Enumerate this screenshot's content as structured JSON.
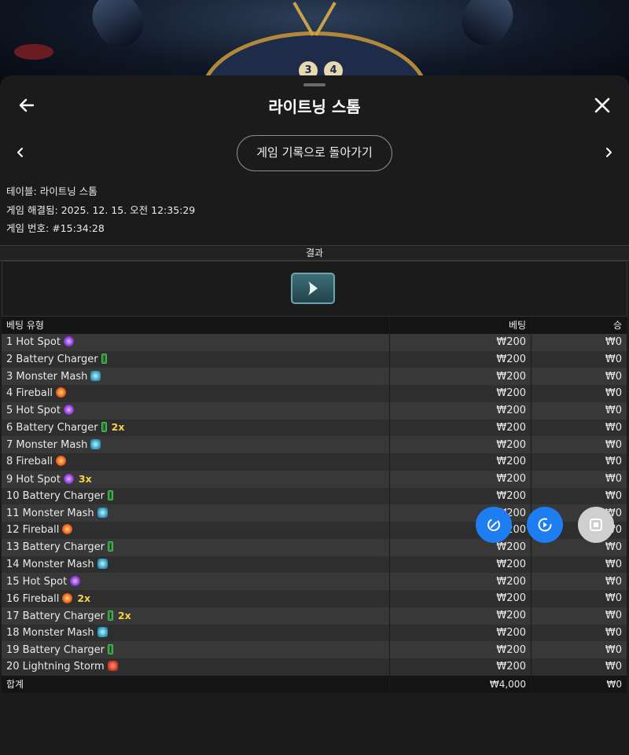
{
  "header": {
    "title": "라이트닝 스톰"
  },
  "background": {
    "wheel_numbers": [
      "3",
      "4"
    ]
  },
  "nav": {
    "back_to_history": "게임 기록으로 돌아가기"
  },
  "info": {
    "table_label": "테이블:",
    "table_value": "라이트닝 스톰",
    "resolved_label": "게임 해결됨:",
    "resolved_value": "2025. 12. 15. 오전 12:35:29",
    "game_no_label": "게임 번호:",
    "game_no_value": "#15:34:28"
  },
  "result": {
    "heading": "결과",
    "icon": "arrow-card-icon"
  },
  "bets": {
    "columns": {
      "type": "베팅 유형",
      "bet": "베팅",
      "win": "승"
    },
    "rows": [
      {
        "label": "1 Hot Spot",
        "icon": "hot-spot",
        "mult": "",
        "bet": "₩200",
        "win": "₩0"
      },
      {
        "label": "2 Battery Charger",
        "icon": "battery",
        "mult": "",
        "bet": "₩200",
        "win": "₩0"
      },
      {
        "label": "3 Monster Mash",
        "icon": "monster",
        "mult": "",
        "bet": "₩200",
        "win": "₩0"
      },
      {
        "label": "4 Fireball",
        "icon": "fireball",
        "mult": "",
        "bet": "₩200",
        "win": "₩0"
      },
      {
        "label": "5 Hot Spot",
        "icon": "hot-spot",
        "mult": "",
        "bet": "₩200",
        "win": "₩0"
      },
      {
        "label": "6 Battery Charger",
        "icon": "battery",
        "mult": "2x",
        "bet": "₩200",
        "win": "₩0"
      },
      {
        "label": "7 Monster Mash",
        "icon": "monster",
        "mult": "",
        "bet": "₩200",
        "win": "₩0"
      },
      {
        "label": "8 Fireball",
        "icon": "fireball",
        "mult": "",
        "bet": "₩200",
        "win": "₩0"
      },
      {
        "label": "9 Hot Spot",
        "icon": "hot-spot",
        "mult": "3x",
        "bet": "₩200",
        "win": "₩0"
      },
      {
        "label": "10 Battery Charger",
        "icon": "battery",
        "mult": "",
        "bet": "₩200",
        "win": "₩0"
      },
      {
        "label": "11 Monster Mash",
        "icon": "monster",
        "mult": "",
        "bet": "₩200",
        "win": "₩0"
      },
      {
        "label": "12 Fireball",
        "icon": "fireball",
        "mult": "",
        "bet": "₩200",
        "win": "₩0"
      },
      {
        "label": "13 Battery Charger",
        "icon": "battery",
        "mult": "",
        "bet": "₩200",
        "win": "₩0"
      },
      {
        "label": "14 Monster Mash",
        "icon": "monster",
        "mult": "",
        "bet": "₩200",
        "win": "₩0"
      },
      {
        "label": "15 Hot Spot",
        "icon": "hot-spot",
        "mult": "",
        "bet": "₩200",
        "win": "₩0"
      },
      {
        "label": "16 Fireball",
        "icon": "fireball",
        "mult": "2x",
        "bet": "₩200",
        "win": "₩0"
      },
      {
        "label": "17 Battery Charger",
        "icon": "battery",
        "mult": "2x",
        "bet": "₩200",
        "win": "₩0"
      },
      {
        "label": "18 Monster Mash",
        "icon": "monster",
        "mult": "",
        "bet": "₩200",
        "win": "₩0"
      },
      {
        "label": "19 Battery Charger",
        "icon": "battery",
        "mult": "",
        "bet": "₩200",
        "win": "₩0"
      },
      {
        "label": "20 Lightning Storm",
        "icon": "lightning-storm",
        "mult": "",
        "bet": "₩200",
        "win": "₩0"
      }
    ],
    "total": {
      "label": "합계",
      "bet": "₩4,000",
      "win": "₩0"
    }
  },
  "floating_buttons": [
    "sync-icon",
    "replay-icon",
    "stop-icon"
  ]
}
